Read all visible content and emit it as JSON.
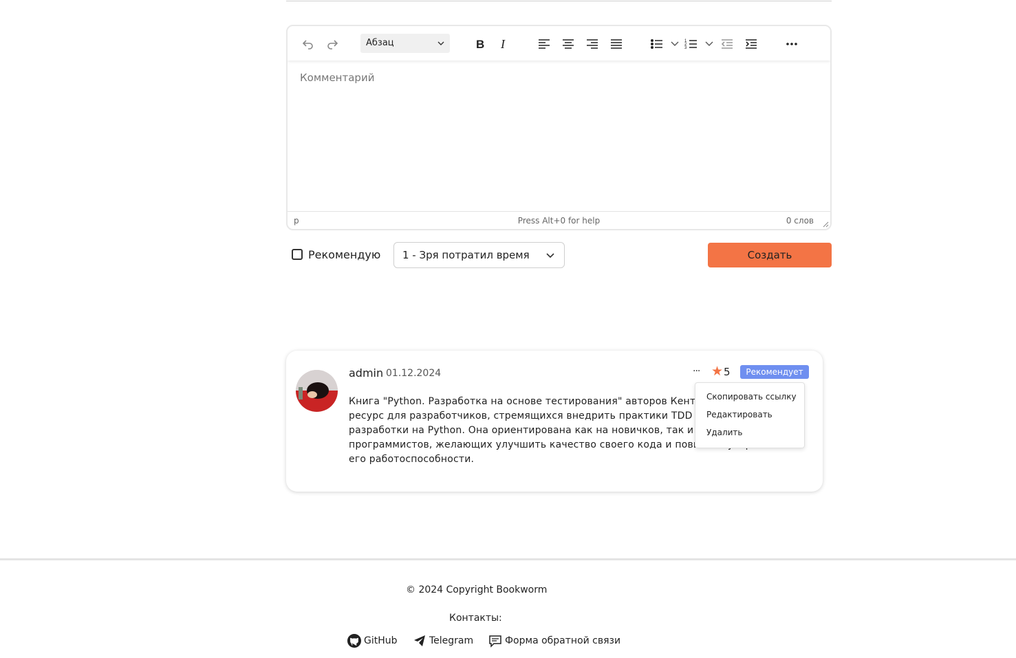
{
  "editor": {
    "format_select": "Абзац",
    "placeholder": "Комментарий",
    "status_path": "p",
    "status_help": "Press Alt+0 for help",
    "status_words": "0 слов"
  },
  "form": {
    "recommend_label": "Рекомендую",
    "rating_value": "1 - Зря потратил время",
    "create_label": "Создать"
  },
  "review": {
    "username": "admin",
    "date": "01.12.2024",
    "more": "···",
    "rating": "5",
    "badge": "Рекомендует",
    "text": "Книга \"Python. Разработка на основе тестирования\" авторов Кента Бека — важный ресурс для разработчиков, стремящихся внедрить практики TDD в процесс разработки на Python. Она ориентирована как на новичков, так и на опытных программистов, желающих улучшить качество своего кода и повысить уверенность в его работоспособности."
  },
  "menu": {
    "copy_link": "Скопировать ссылку",
    "edit": "Редактировать",
    "delete": "Удалить"
  },
  "footer": {
    "copyright": "© 2024 Copyright Bookworm",
    "contacts": "Контакты:",
    "github": "GitHub",
    "telegram": "Telegram",
    "feedback": "Форма обратной связи"
  },
  "colors": {
    "accent": "#f37445",
    "badge": "#6f8ff0"
  }
}
